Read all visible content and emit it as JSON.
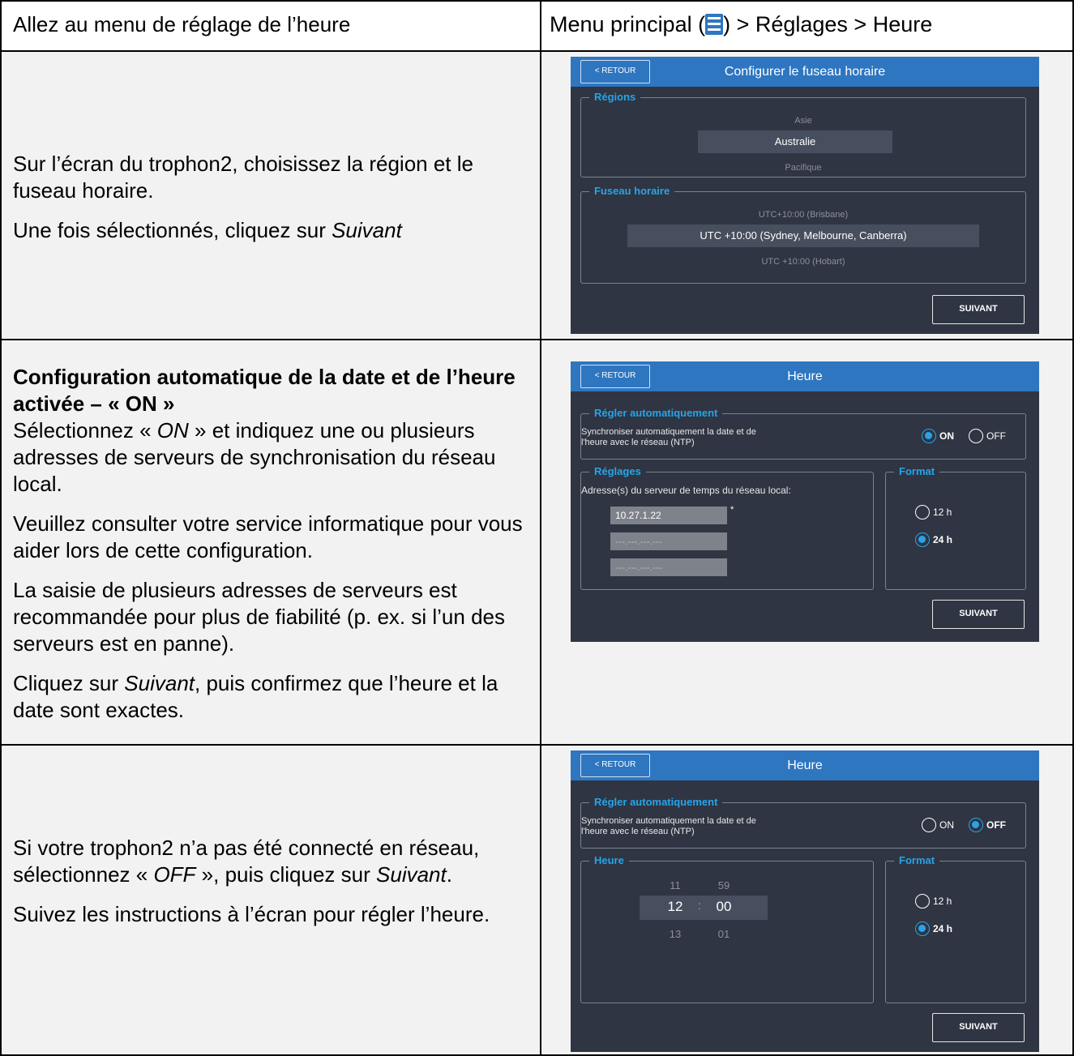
{
  "doc": {
    "row1": {
      "left": "Allez au menu de réglage de l’heure",
      "right_pre": "Menu principal (",
      "right_post": ") > Réglages > Heure",
      "menu_icon": "hamburger-menu-icon"
    },
    "row2": {
      "p1": "Sur l’écran du trophon2, choisissez la région et le fuseau horaire.",
      "p2_pre": "Une fois sélectionnés, cliquez sur ",
      "p2_it": "Suivant"
    },
    "row3": {
      "heading": "Configuration automatique de la date et de l’heure activée – « ON »",
      "p1_pre": "Sélectionnez « ",
      "p1_it": "ON",
      "p1_post": " » et indiquez une ou plusieurs adresses de serveurs de synchronisation du réseau local.",
      "p2": "Veuillez consulter votre service informatique pour vous aider lors de cette configuration.",
      "p3": "La saisie de plusieurs adresses de serveurs est recommandée pour plus de fiabilité (p. ex. si l’un des serveurs est en panne).",
      "p4_pre": "Cliquez sur ",
      "p4_it": "Suivant",
      "p4_post": ", puis confirmez que l’heure et la date sont exactes."
    },
    "row4": {
      "p1_pre": "Si votre trophon2 n’a pas été connecté en réseau, sélectionnez « ",
      "p1_it": "OFF",
      "p1_mid": " », puis cliquez sur ",
      "p1_it2": "Suivant",
      "p1_post": ".",
      "p2": "Suivez les instructions à l’écran pour régler l’heure."
    }
  },
  "screen1": {
    "back": "< RETOUR",
    "title": "Configurer le fuseau horaire",
    "regions_legend": "Régions",
    "regions": [
      "Asie",
      "Australie",
      "Pacifique"
    ],
    "tz_legend": "Fuseau horaire",
    "timezones": [
      "UTC+10:00 (Brisbane)",
      "UTC +10:00 (Sydney, Melbourne, Canberra)",
      "UTC +10:00 (Hobart)"
    ],
    "next": "SUIVANT"
  },
  "screen2": {
    "back": "< RETOUR",
    "title": "Heure",
    "auto_legend": "Régler automatiquement",
    "sync_line1": "Synchroniser automatiquement la date et de",
    "sync_line2": "l'heure avec le réseau (NTP)",
    "on": "ON",
    "off": "OFF",
    "settings_legend": "Réglages",
    "server_label": "Adresse(s) du serveur de temps du réseau local:",
    "servers": [
      "10.27.1.22",
      "---.---.---.---",
      "---.---.---.---"
    ],
    "required_mark": "*",
    "format_legend": "Format",
    "fmt12": "12 h",
    "fmt24": "24 h",
    "next": "SUIVANT"
  },
  "screen3": {
    "back": "< RETOUR",
    "title": "Heure",
    "auto_legend": "Régler automatiquement",
    "sync_line1": "Synchroniser automatiquement la date et de",
    "sync_line2": "l'heure avec le réseau (NTP)",
    "on": "ON",
    "off": "OFF",
    "time_legend": "Heure",
    "hours": [
      "11",
      "12",
      "13"
    ],
    "minutes": [
      "59",
      "00",
      "01"
    ],
    "sep": ":",
    "format_legend": "Format",
    "fmt12": "12 h",
    "fmt24": "24 h",
    "next": "SUIVANT"
  }
}
